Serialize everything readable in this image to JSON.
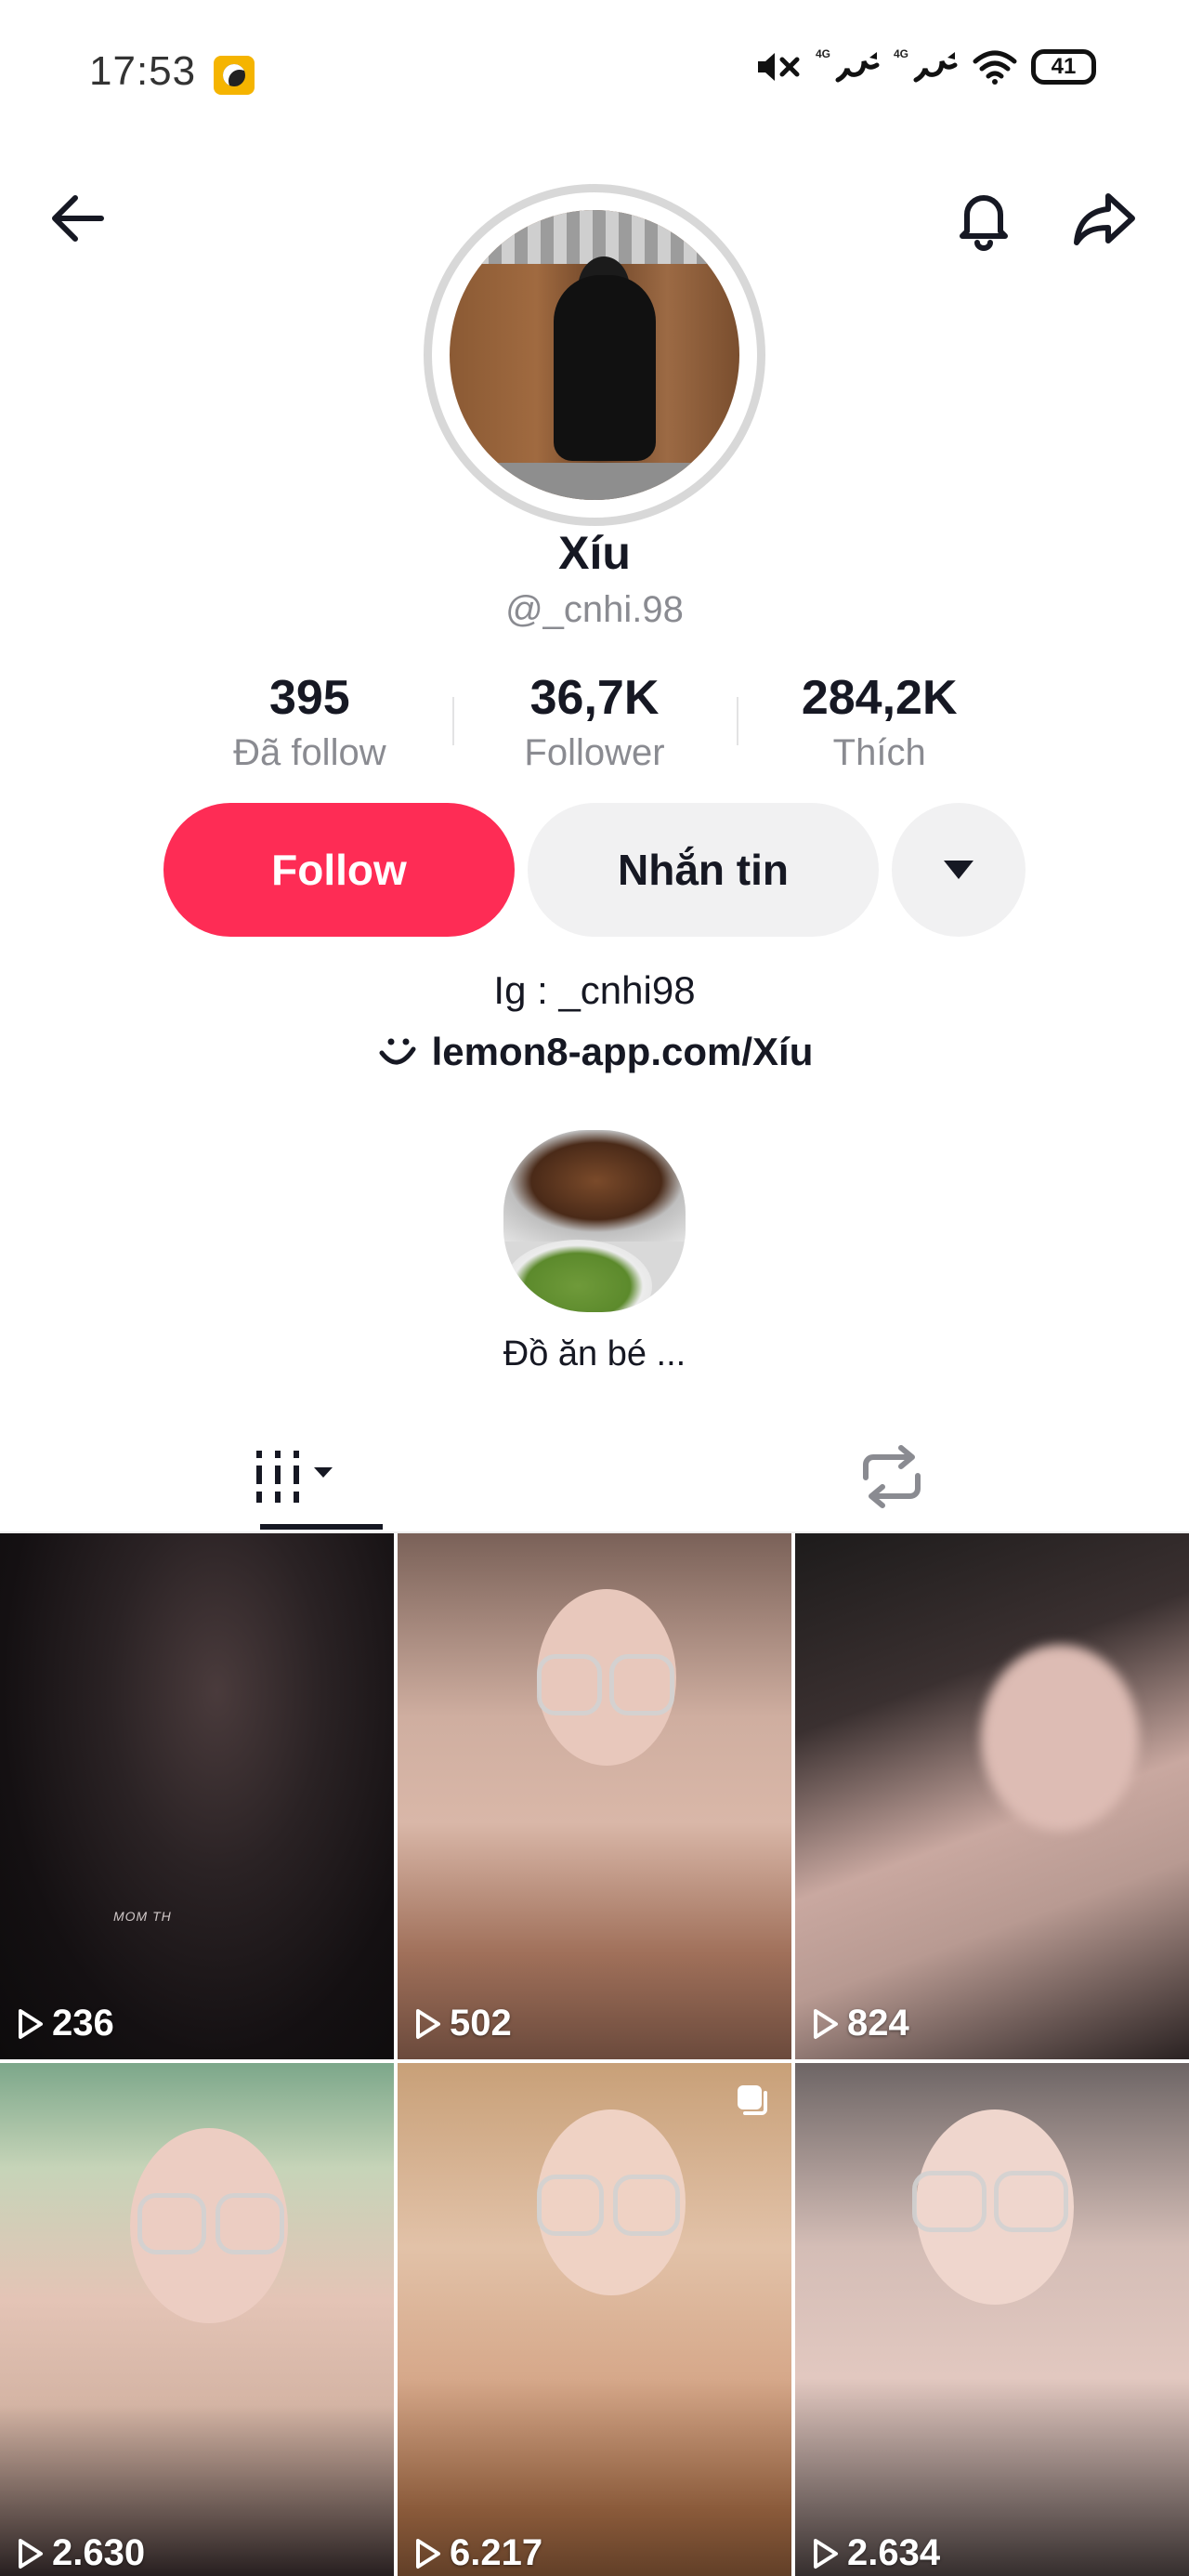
{
  "status_bar": {
    "time": "17:53",
    "network_1": "4G",
    "network_2": "4G",
    "battery": "41"
  },
  "profile": {
    "display_name": "Xíu",
    "username": "@_cnhi.98",
    "stats": [
      {
        "value": "395",
        "label": "Đã follow"
      },
      {
        "value": "36,7K",
        "label": "Follower"
      },
      {
        "value": "284,2K",
        "label": "Thích"
      }
    ],
    "bio": "Ig : _cnhi98",
    "link": "lemon8-app.com/Xíu"
  },
  "actions": {
    "follow_label": "Follow",
    "message_label": "Nhắn tin"
  },
  "highlight": {
    "label": "Đồ ăn bé ..."
  },
  "videos": [
    {
      "views": "236"
    },
    {
      "views": "502"
    },
    {
      "views": "824"
    },
    {
      "views": "2.630"
    },
    {
      "views": "6.217"
    },
    {
      "views": "2.634"
    }
  ],
  "overlay_text": "MOM TH",
  "colors": {
    "accent": "#fe2c55",
    "text_primary": "#161823",
    "text_secondary": "#8a8b91",
    "button_secondary": "#f1f1f2"
  },
  "icons": [
    "back-arrow-icon",
    "bell-icon",
    "share-icon",
    "dropdown-caret-icon",
    "lemon8-icon",
    "videos-grid-icon",
    "repost-icon",
    "play-icon",
    "multi-photo-icon",
    "mute-icon",
    "wifi-icon",
    "signal-icon"
  ]
}
